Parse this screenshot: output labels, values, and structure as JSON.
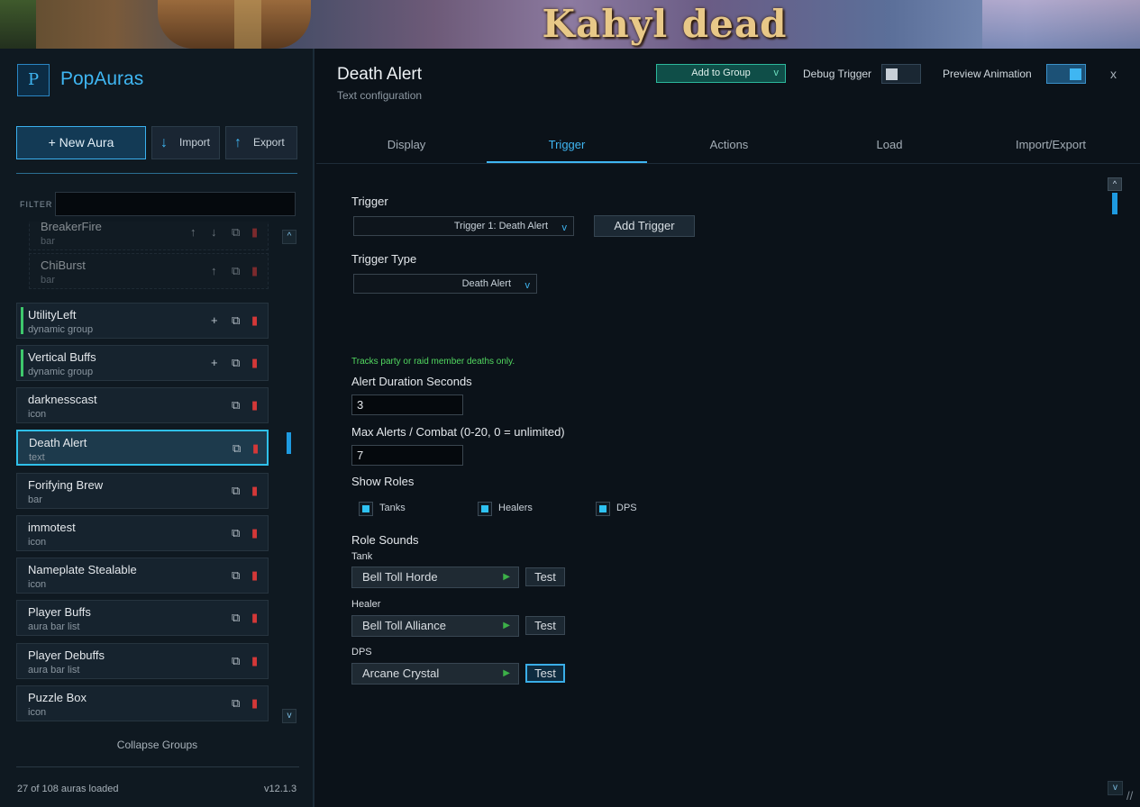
{
  "banner": {
    "title": "Kahyl dead"
  },
  "app": {
    "logo_letter": "P",
    "title": "PopAuras"
  },
  "toolbar": {
    "new_aura": "+  New Aura",
    "import": "Import",
    "export": "Export",
    "import_icon": "↓",
    "export_icon": "↑"
  },
  "filter": {
    "label": "FILTER",
    "value": ""
  },
  "auras": [
    {
      "name": "BreakerFire",
      "type": "bar",
      "variant": "sub"
    },
    {
      "name": "ChiBurst",
      "type": "bar",
      "variant": "sub"
    },
    {
      "name": "UtilityLeft",
      "type": "dynamic group",
      "variant": "group"
    },
    {
      "name": "Vertical Buffs",
      "type": "dynamic group",
      "variant": "group"
    },
    {
      "name": "darknesscast",
      "type": "icon",
      "variant": "normal"
    },
    {
      "name": "Death Alert",
      "type": "text",
      "variant": "active"
    },
    {
      "name": "Forifying Brew",
      "type": "bar",
      "variant": "normal"
    },
    {
      "name": "immotest",
      "type": "icon",
      "variant": "normal"
    },
    {
      "name": "Nameplate Stealable",
      "type": "icon",
      "variant": "normal"
    },
    {
      "name": "Player Buffs",
      "type": "aura bar list",
      "variant": "normal"
    },
    {
      "name": "Player Debuffs",
      "type": "aura bar list",
      "variant": "normal"
    },
    {
      "name": "Puzzle Box",
      "type": "icon",
      "variant": "normal"
    }
  ],
  "sidebar_footer": {
    "collapse": "Collapse Groups",
    "count": "27 of 108 auras loaded",
    "version": "v12.1.3"
  },
  "header": {
    "title": "Death Alert",
    "subtitle": "Text configuration",
    "add_to_group": "Add to Group",
    "debug_trigger": "Debug Trigger",
    "debug_trigger_on": false,
    "preview_animation": "Preview Animation",
    "preview_animation_on": true,
    "close": "x"
  },
  "tabs": [
    "Display",
    "Trigger",
    "Actions",
    "Load",
    "Import/Export"
  ],
  "active_tab": "Trigger",
  "trigger": {
    "label": "Trigger",
    "selected": "Trigger 1: Death Alert",
    "add_button": "Add Trigger",
    "type_label": "Trigger Type",
    "type_selected": "Death Alert",
    "hint": "Tracks party or raid member deaths only.",
    "duration_label": "Alert Duration Seconds",
    "duration_value": "3",
    "max_label": "Max Alerts / Combat (0-20, 0 = unlimited)",
    "max_value": "7",
    "roles_label": "Show Roles",
    "roles": [
      {
        "label": "Tanks",
        "checked": true
      },
      {
        "label": "Healers",
        "checked": true
      },
      {
        "label": "DPS",
        "checked": true
      }
    ],
    "sounds_label": "Role Sounds",
    "sounds": [
      {
        "role": "Tank",
        "sound": "Bell Toll Horde",
        "test": "Test"
      },
      {
        "role": "Healer",
        "sound": "Bell Toll Alliance",
        "test": "Test"
      },
      {
        "role": "DPS",
        "sound": "Arcane Crystal",
        "test": "Test"
      }
    ]
  },
  "colors": {
    "accent": "#3fb6f2",
    "group_bar": "#3ec86c",
    "delete": "#d43838",
    "hint": "#52d860"
  }
}
